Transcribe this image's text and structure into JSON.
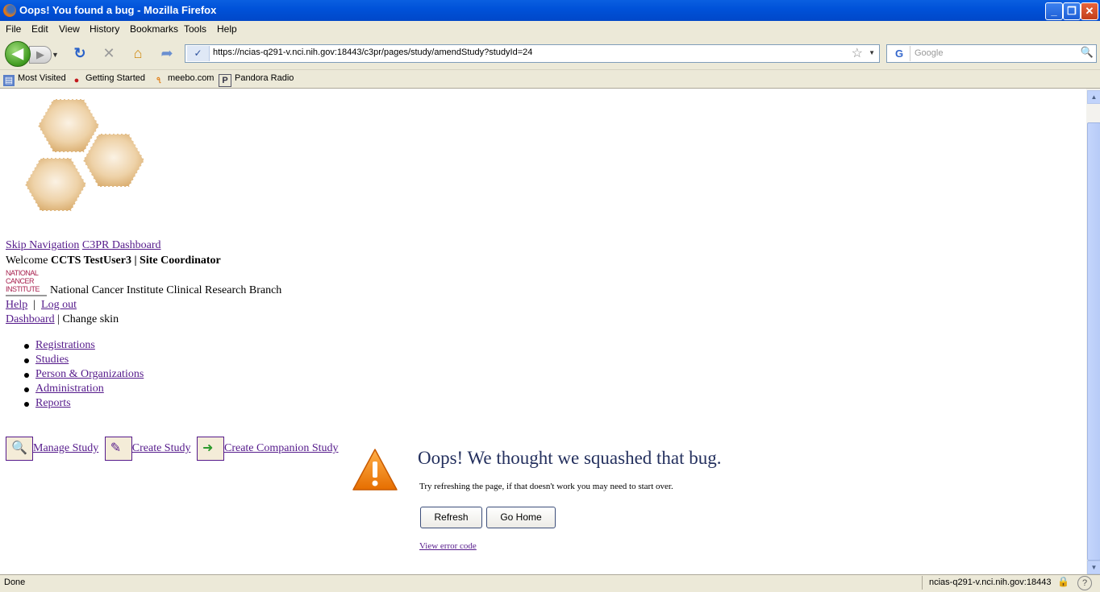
{
  "window": {
    "title": "Oops! You found a bug - Mozilla Firefox"
  },
  "menubar": {
    "items": [
      "File",
      "Edit",
      "View",
      "History",
      "Bookmarks",
      "Tools",
      "Help"
    ]
  },
  "navbar": {
    "url": "https://ncias-q291-v.nci.nih.gov:18443/c3pr/pages/study/amendStudy?studyId=24",
    "search_placeholder": "Google"
  },
  "bookmarks": [
    "Most Visited",
    "Getting Started",
    "meebo.com",
    "Pandora Radio"
  ],
  "page": {
    "skip_nav": "Skip Navigation",
    "dashboard_link": "C3PR Dashboard",
    "welcome_prefix": "Welcome",
    "welcome_user": "CCTS TestUser3 | Site Coordinator",
    "nci_logo_lines": [
      "NATIONAL",
      "CANCER",
      "INSTITUTE"
    ],
    "nci_branch": "National Cancer Institute Clinical Research Branch",
    "help": "Help",
    "separator": "|",
    "logout": "Log out",
    "dashboard": "Dashboard",
    "change_skin": "| Change skin",
    "nav_items": [
      "Registrations",
      "Studies",
      "Person & Organizations",
      "Administration",
      "Reports"
    ],
    "actions": [
      "Manage Study",
      "Create Study",
      "Create Companion Study"
    ]
  },
  "error": {
    "heading": "Oops! We thought we squashed that bug.",
    "message": "Try refreshing the page, if that doesn't work you may need to start over.",
    "refresh": "Refresh",
    "go_home": "Go Home",
    "view_code": "View error code"
  },
  "statusbar": {
    "text": "Done",
    "host": "ncias-q291-v.nci.nih.gov:18443"
  }
}
